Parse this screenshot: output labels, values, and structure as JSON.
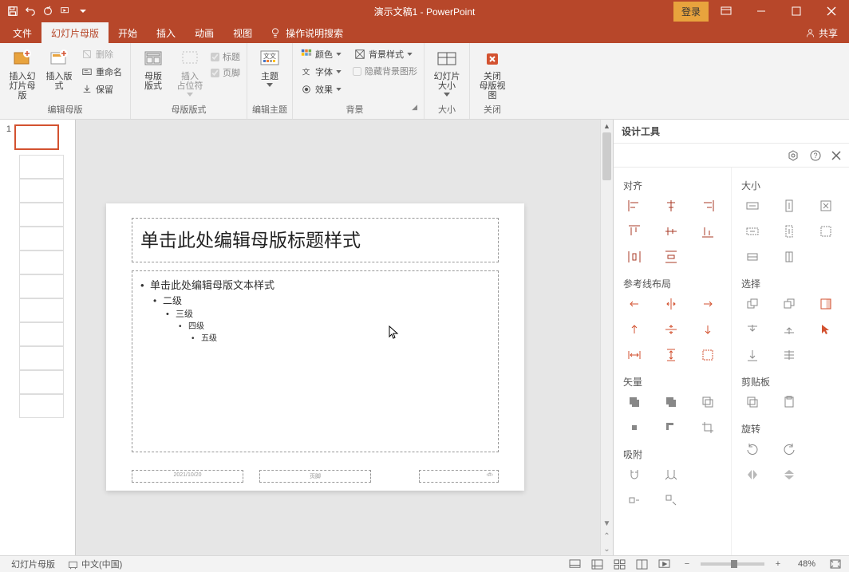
{
  "titlebar": {
    "title": "演示文稿1  -  PowerPoint",
    "login": "登录"
  },
  "tabs": {
    "file": "文件",
    "slidemaster": "幻灯片母版",
    "home": "开始",
    "insert": "插入",
    "animation": "动画",
    "view": "视图",
    "tell": "操作说明搜索",
    "share": "共享"
  },
  "ribbon": {
    "group1": {
      "label": "编辑母版",
      "insert_slide_master": "插入幻\n灯片母版",
      "insert_layout": "插入版式",
      "delete": "删除",
      "rename": "重命名",
      "preserve": "保留"
    },
    "group2": {
      "label": "母版版式",
      "master_layout": "母版\n版式",
      "insert_placeholder": "插入\n占位符",
      "title_chk": "标题",
      "footer_chk": "页脚"
    },
    "group3": {
      "label": "编辑主题",
      "themes": "主题"
    },
    "group4": {
      "label": "背景",
      "colors": "颜色",
      "fonts": "字体",
      "effects": "效果",
      "bg_styles": "背景样式",
      "hide_bg": "隐藏背景图形"
    },
    "group5": {
      "label": "大小",
      "slide_size": "幻灯片\n大小"
    },
    "group6": {
      "label": "关闭",
      "close_master": "关闭\n母版视图"
    }
  },
  "slide": {
    "title_ph": "单击此处编辑母版标题样式",
    "body_ph": "单击此处编辑母版文本样式",
    "lv2": "二级",
    "lv3": "三级",
    "lv4": "四级",
    "lv5": "五级",
    "date": "2021/10/20",
    "footer": "页脚"
  },
  "thumbs": {
    "num1": "1"
  },
  "pane": {
    "title": "设计工具",
    "sec_align": "对齐",
    "sec_size": "大小",
    "sec_ref": "参考线布局",
    "sec_select": "选择",
    "sec_vector": "矢量",
    "sec_clip": "剪贴板",
    "sec_snap": "吸附",
    "sec_rotate": "旋转"
  },
  "status": {
    "view": "幻灯片母版",
    "lang": "中文(中国)",
    "zoom": "48%"
  }
}
